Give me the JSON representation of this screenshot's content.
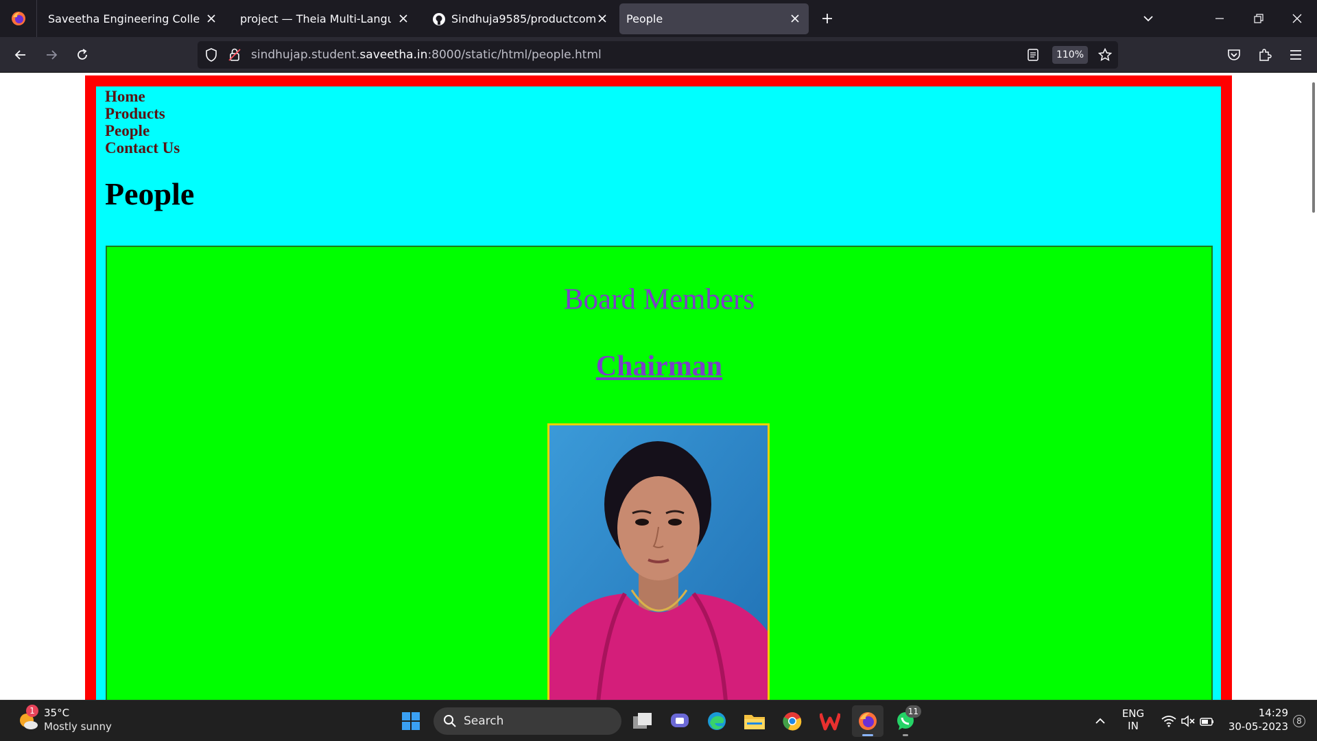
{
  "browser": {
    "tabs": [
      {
        "title": "Saveetha Engineering College",
        "active": false
      },
      {
        "title": "project — Theia Multi-Language Ex",
        "active": false
      },
      {
        "title": "Sindhuja9585/productcompany",
        "active": false
      },
      {
        "title": "People",
        "active": true
      }
    ],
    "url_prefix": "sindhujap.student.",
    "url_host": "saveetha.in",
    "url_suffix": ":8000/static/html/people.html",
    "zoom": "110%"
  },
  "page": {
    "nav": [
      "Home",
      "Products",
      "People",
      "Contact Us"
    ],
    "heading": "People",
    "board_title": "Board Members",
    "chairman_label": "Chairman",
    "colors": {
      "outer_border": "#ff0000",
      "inner_bg": "#00ffff",
      "board_bg": "#00ff00",
      "title_text": "#7b3fc6",
      "nav_text": "#5a1313",
      "photo_frame": "#f2d000"
    }
  },
  "taskbar": {
    "weather_temp": "35°C",
    "weather_desc": "Mostly sunny",
    "weather_badge": "1",
    "search_label": "Search",
    "whatsapp_badge": "11",
    "lang_top": "ENG",
    "lang_bottom": "IN",
    "time": "14:29",
    "date": "30-05-2023",
    "notification_count": "8"
  }
}
